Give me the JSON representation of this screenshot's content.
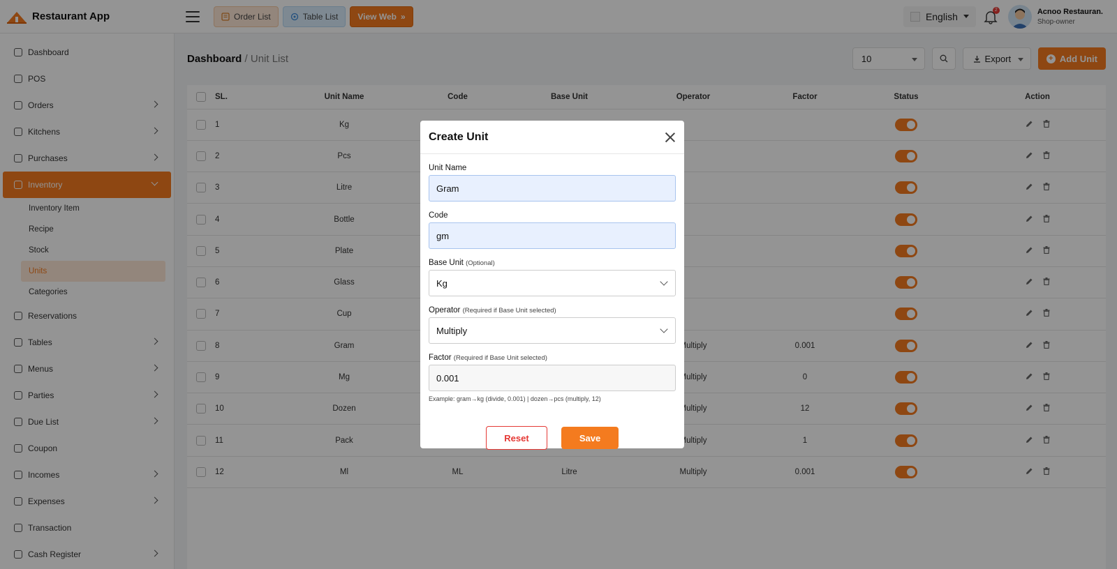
{
  "header": {
    "app_name": "Restaurant App",
    "order_list_label": "Order List",
    "table_list_label": "Table List",
    "view_web_label": "View Web",
    "language": "English",
    "notification_count": "2",
    "user_name": "Acnoo Restauran.",
    "user_role": "Shop-owner"
  },
  "sidebar": {
    "items": [
      {
        "label": "Dashboard",
        "icon": "dashboard-icon",
        "chevron": false
      },
      {
        "label": "POS",
        "icon": "pos-icon",
        "chevron": false
      },
      {
        "label": "Orders",
        "icon": "orders-icon",
        "chevron": true
      },
      {
        "label": "Kitchens",
        "icon": "kitchen-icon",
        "chevron": true
      },
      {
        "label": "Purchases",
        "icon": "purchases-icon",
        "chevron": true
      },
      {
        "label": "Inventory",
        "icon": "inventory-icon",
        "chevron": true,
        "active": true
      },
      {
        "label": "Reservations",
        "icon": "reservations-icon",
        "chevron": false
      },
      {
        "label": "Tables",
        "icon": "tables-icon",
        "chevron": true
      },
      {
        "label": "Menus",
        "icon": "menus-icon",
        "chevron": true
      },
      {
        "label": "Parties",
        "icon": "parties-icon",
        "chevron": true
      },
      {
        "label": "Due List",
        "icon": "due-list-icon",
        "chevron": true
      },
      {
        "label": "Coupon",
        "icon": "coupon-icon",
        "chevron": false
      },
      {
        "label": "Incomes",
        "icon": "incomes-icon",
        "chevron": true
      },
      {
        "label": "Expenses",
        "icon": "expenses-icon",
        "chevron": true
      },
      {
        "label": "Transaction",
        "icon": "transaction-icon",
        "chevron": false
      },
      {
        "label": "Cash Register",
        "icon": "cash-register-icon",
        "chevron": true
      }
    ],
    "inventory_sub": [
      {
        "label": "Inventory Item"
      },
      {
        "label": "Recipe"
      },
      {
        "label": "Stock"
      },
      {
        "label": "Units",
        "current": true
      },
      {
        "label": "Categories"
      }
    ]
  },
  "page": {
    "breadcrumb_home": "Dashboard",
    "breadcrumb_sep": " / ",
    "breadcrumb_current": "Unit List",
    "per_page": "10",
    "export_label": "Export",
    "add_label": "Add Unit"
  },
  "table": {
    "headers": [
      "SL.",
      "Unit Name",
      "Code",
      "Base Unit",
      "Operator",
      "Factor",
      "Status",
      "Action"
    ],
    "rows": [
      {
        "sl": "1",
        "name": "Kg",
        "code": "",
        "base": "",
        "op": "",
        "factor": ""
      },
      {
        "sl": "2",
        "name": "Pcs",
        "code": "",
        "base": "",
        "op": "",
        "factor": ""
      },
      {
        "sl": "3",
        "name": "Litre",
        "code": "",
        "base": "",
        "op": "",
        "factor": ""
      },
      {
        "sl": "4",
        "name": "Bottle",
        "code": "",
        "base": "",
        "op": "",
        "factor": ""
      },
      {
        "sl": "5",
        "name": "Plate",
        "code": "",
        "base": "",
        "op": "",
        "factor": ""
      },
      {
        "sl": "6",
        "name": "Glass",
        "code": "",
        "base": "",
        "op": "",
        "factor": ""
      },
      {
        "sl": "7",
        "name": "Cup",
        "code": "",
        "base": "",
        "op": "",
        "factor": ""
      },
      {
        "sl": "8",
        "name": "Gram",
        "code": "",
        "base": "",
        "op": "Multiply",
        "factor": "0.001"
      },
      {
        "sl": "9",
        "name": "Mg",
        "code": "",
        "base": "",
        "op": "Multiply",
        "factor": "0"
      },
      {
        "sl": "10",
        "name": "Dozen",
        "code": "",
        "base": "",
        "op": "Multiply",
        "factor": "12"
      },
      {
        "sl": "11",
        "name": "Pack",
        "code": "",
        "base": "",
        "op": "Multiply",
        "factor": "1"
      },
      {
        "sl": "12",
        "name": "Ml",
        "code": "ML",
        "base": "Litre",
        "op": "Multiply",
        "factor": "0.001"
      }
    ]
  },
  "modal": {
    "title": "Create Unit",
    "unit_name_label": "Unit Name",
    "unit_name_value": "Gram",
    "code_label": "Code",
    "code_value": "gm",
    "base_unit_label": "Base Unit",
    "base_unit_hint": "(Optional)",
    "base_unit_value": "Kg",
    "operator_label": "Operator",
    "operator_hint": "(Required if Base Unit selected)",
    "operator_value": "Multiply",
    "factor_label": "Factor",
    "factor_hint": "(Required if Base Unit selected)",
    "factor_value": "0.001",
    "example": "Example: gram→kg (divide, 0.001) | dozen→pcs (multiply, 12)",
    "reset_label": "Reset",
    "save_label": "Save"
  },
  "colors": {
    "accent": "#f47b1f",
    "danger": "#e53935"
  }
}
